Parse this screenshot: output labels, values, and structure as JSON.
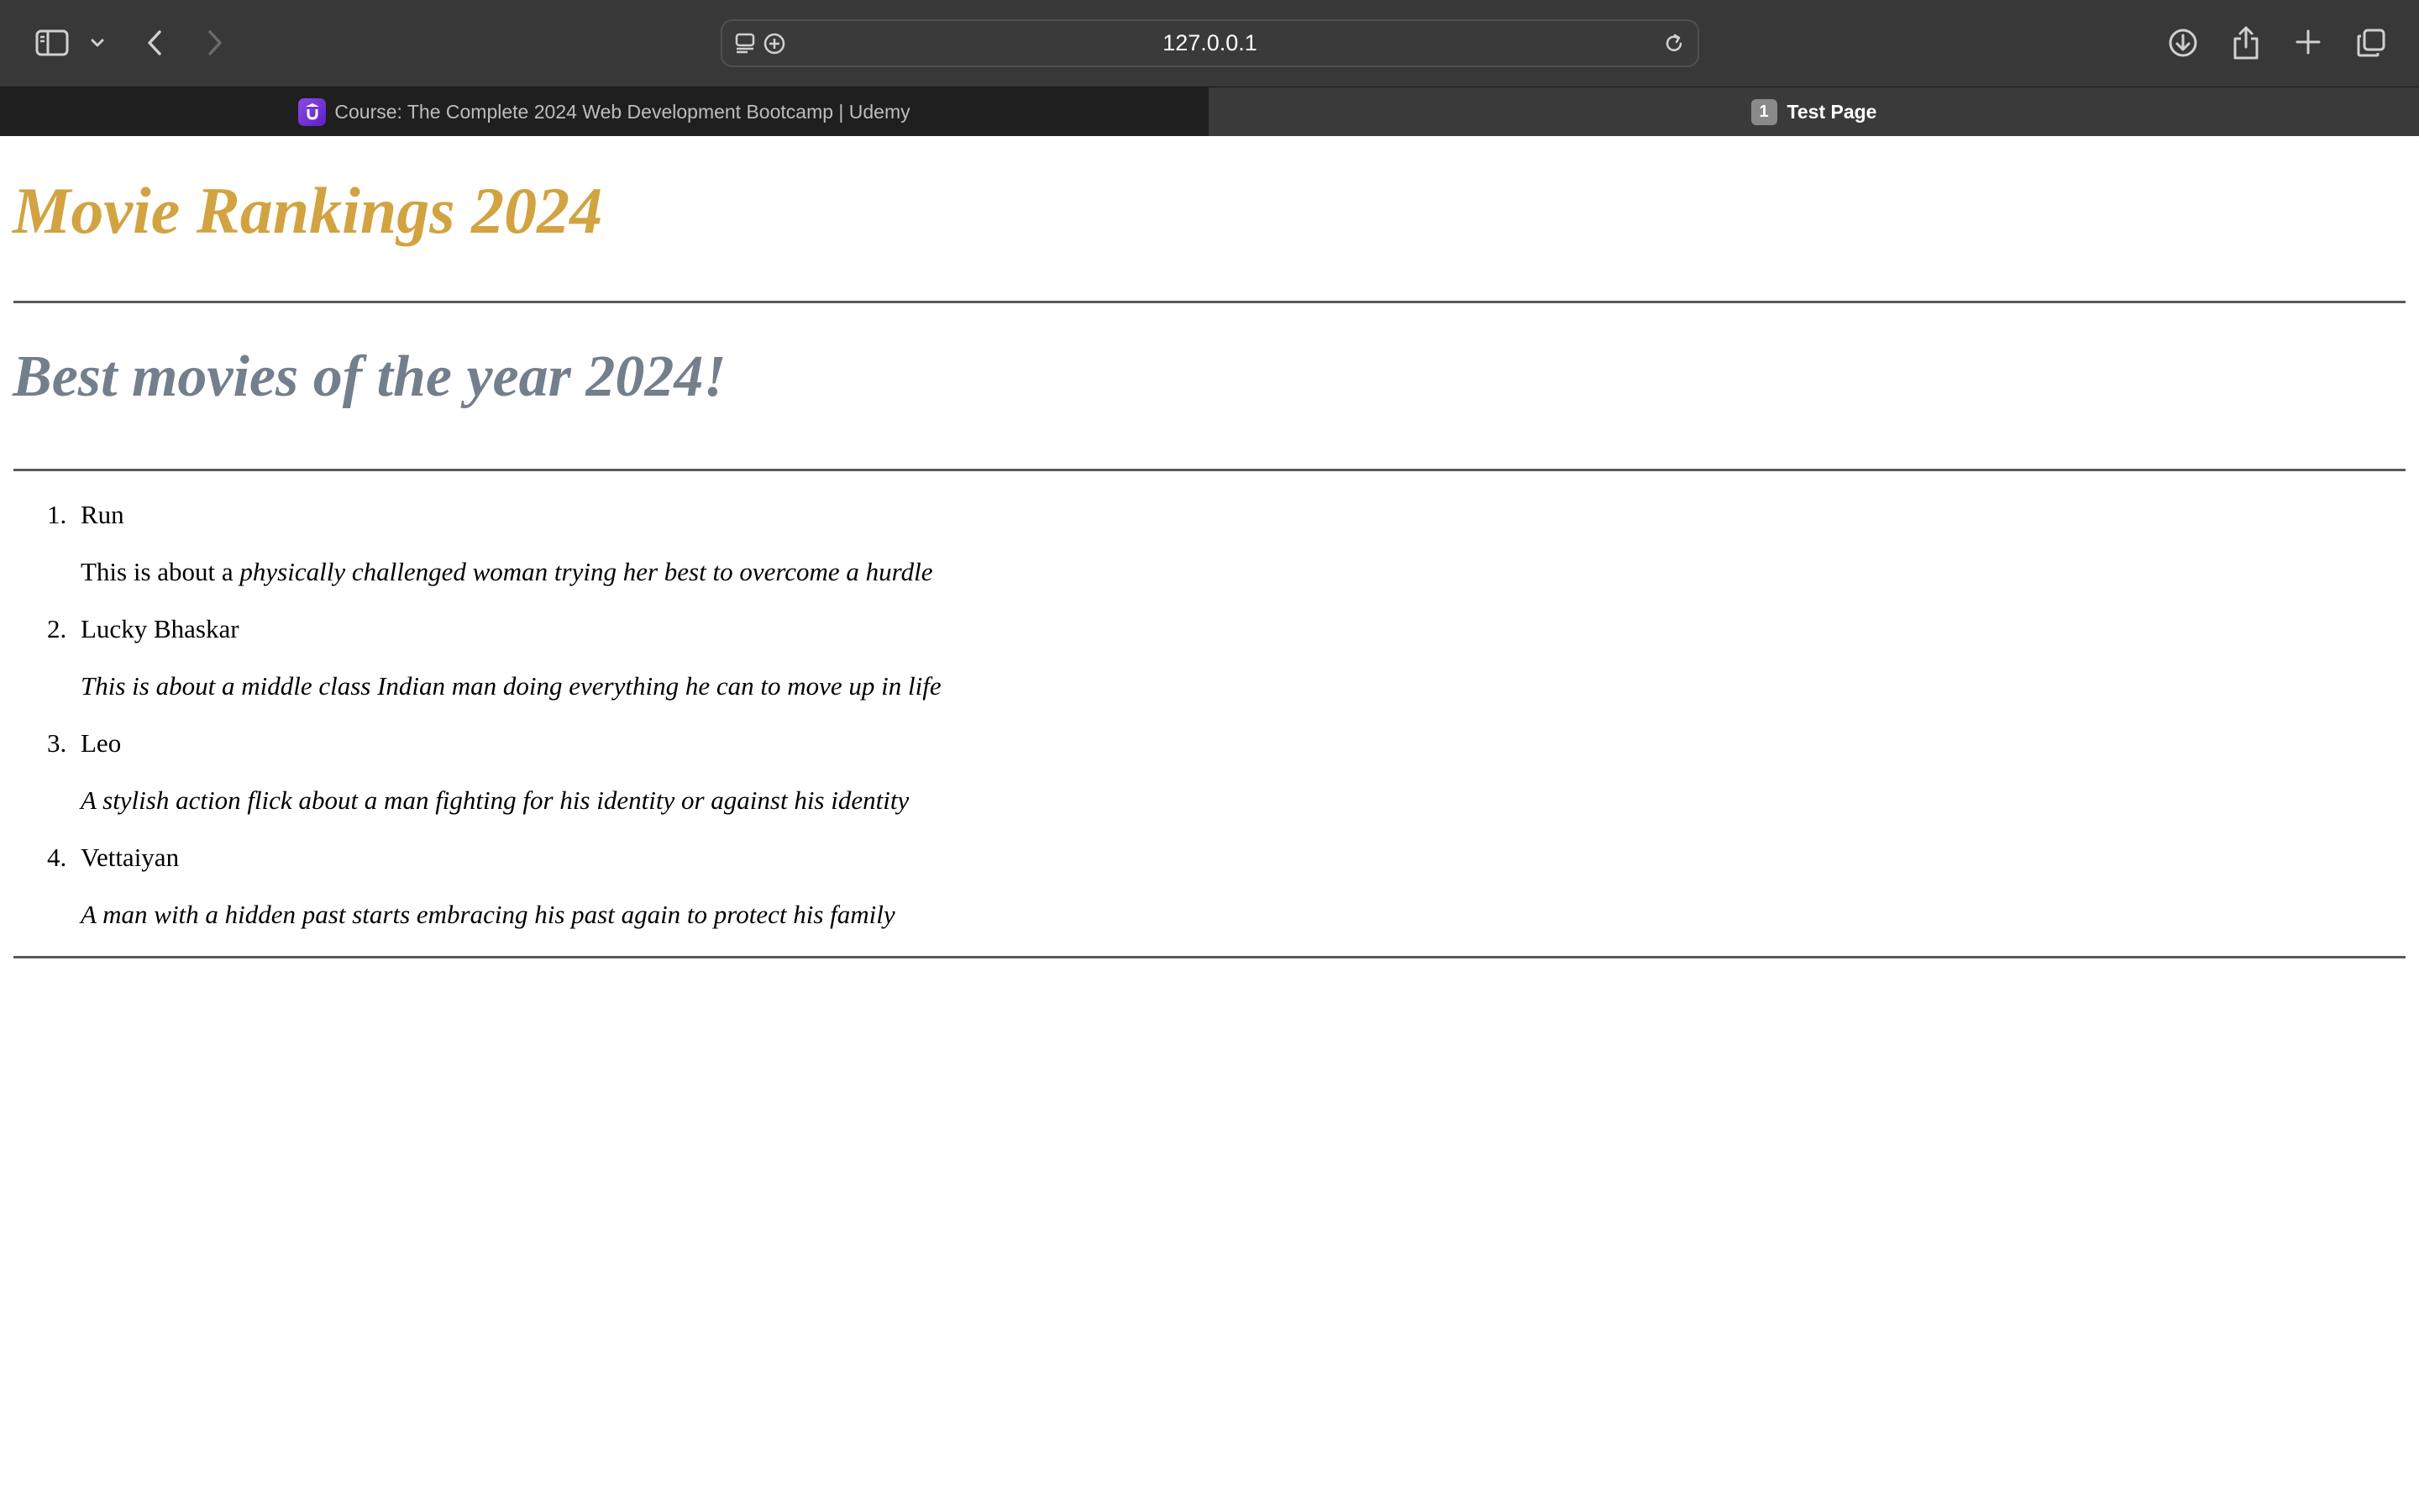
{
  "browser": {
    "address": "127.0.0.1",
    "tabs": [
      {
        "title": "Course: The Complete 2024 Web Development Bootcamp | Udemy",
        "favicon": "udemy-icon",
        "active": false
      },
      {
        "title": "Test Page",
        "badge": "1",
        "active": true
      }
    ],
    "icons": {
      "sidebar": "sidebar-icon",
      "sidebar_menu": "chevron-down-icon",
      "back": "chevron-left-icon",
      "forward": "chevron-right-icon",
      "reader": "reader-icon",
      "extensions": "plus-circle-icon",
      "reload": "reload-icon",
      "downloads": "download-icon",
      "share": "share-icon",
      "new_tab": "plus-icon",
      "tab_overview": "tabs-icon",
      "close_tab": "close-icon"
    }
  },
  "page": {
    "title": "Movie Rankings 2024",
    "subtitle": "Best movies of the year 2024!",
    "colors": {
      "title": "#d2a341",
      "subtitle": "#737f8c"
    },
    "movies": [
      {
        "number": "1.",
        "title": "Run",
        "desc_plain": "This is about a ",
        "desc_italic": "physically challenged woman trying her best to overcome a hurdle"
      },
      {
        "number": "2.",
        "title": "Lucky Bhaskar",
        "desc_plain": "",
        "desc_italic": "This is about a middle class Indian man doing everything he can to move up in life"
      },
      {
        "number": "3.",
        "title": "Leo",
        "desc_plain": "",
        "desc_italic": "A stylish action flick about a man fighting for his identity or against his identity"
      },
      {
        "number": "4.",
        "title": "Vettaiyan",
        "desc_plain": "",
        "desc_italic": "A man with a hidden past starts embracing his past again to protect his family"
      }
    ]
  }
}
